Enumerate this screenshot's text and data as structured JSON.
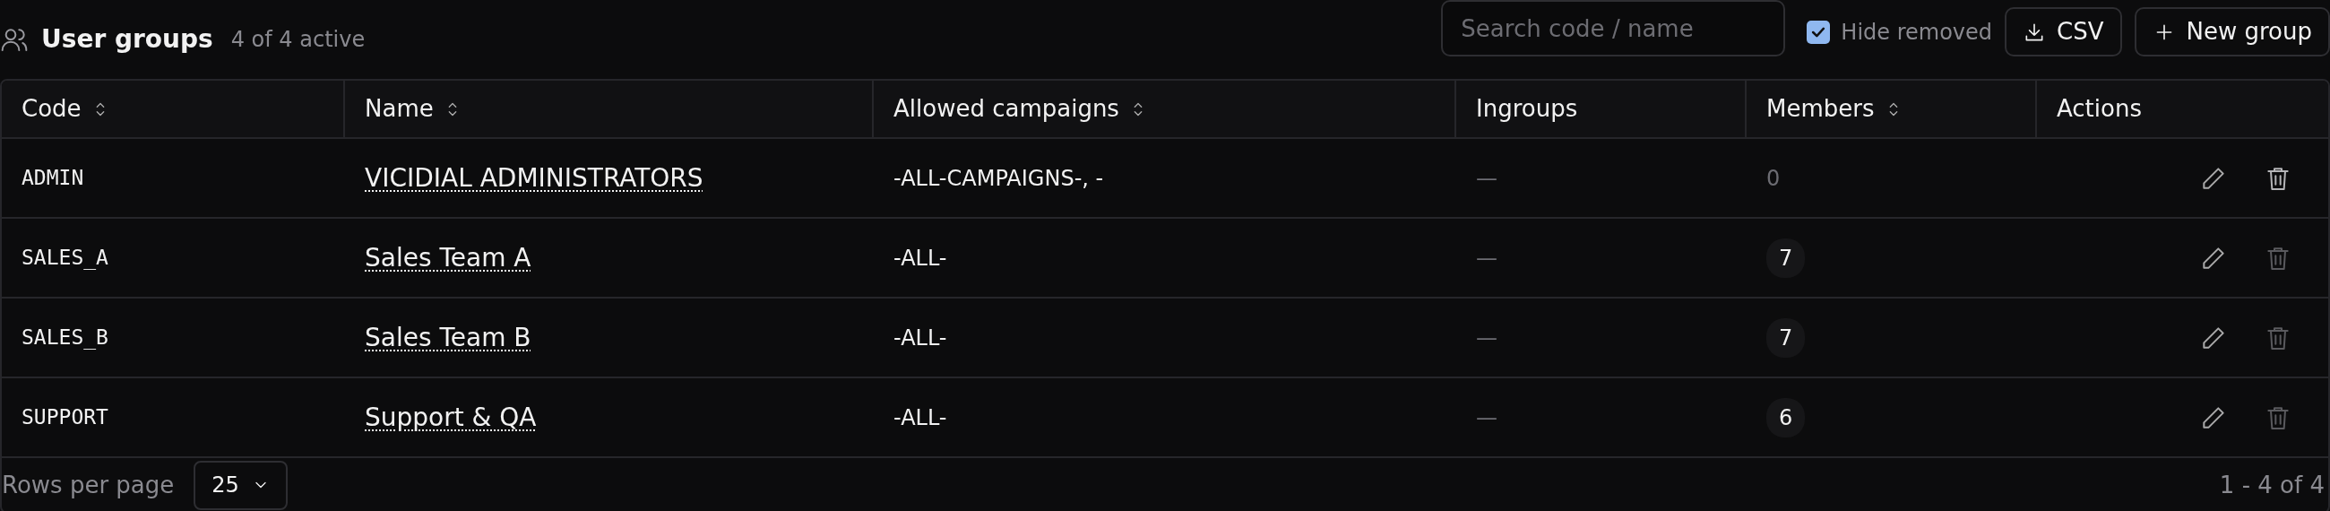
{
  "header": {
    "title": "User groups",
    "subtitle": "4 of 4 active"
  },
  "search": {
    "placeholder": "Search code / name"
  },
  "hide_removed": {
    "label": "Hide removed",
    "checked": true
  },
  "buttons": [
    {
      "kind": "download",
      "label": "CSV"
    },
    {
      "kind": "add",
      "label": "New group"
    }
  ],
  "table": {
    "columns": [
      {
        "label": "Code",
        "sortable": true
      },
      {
        "label": "Name",
        "sortable": true
      },
      {
        "label": "Allowed campaigns",
        "sortable": true
      },
      {
        "label": "Ingroups",
        "sortable": false
      },
      {
        "label": "Members",
        "sortable": true
      },
      {
        "label": "Actions",
        "sortable": false
      }
    ],
    "rows": [
      {
        "code": "ADMIN",
        "name": "VICIDIAL ADMINISTRATORS",
        "campaigns": "-ALL-CAMPAIGNS-, -",
        "ingroups": "—",
        "members": "0",
        "members_badge": false,
        "delete_disabled": false
      },
      {
        "code": "SALES_A",
        "name": "Sales Team A",
        "campaigns": "-ALL-",
        "ingroups": "—",
        "members": "7",
        "members_badge": true,
        "delete_disabled": true
      },
      {
        "code": "SALES_B",
        "name": "Sales Team B",
        "campaigns": "-ALL-",
        "ingroups": "—",
        "members": "7",
        "members_badge": true,
        "delete_disabled": true
      },
      {
        "code": "SUPPORT",
        "name": "Support & QA",
        "campaigns": "-ALL-",
        "ingroups": "—",
        "members": "6",
        "members_badge": true,
        "delete_disabled": true
      }
    ]
  },
  "footer": {
    "rows_per_page_label": "Rows per page",
    "rows_per_page": "25",
    "range": "1 - 4 of 4"
  }
}
